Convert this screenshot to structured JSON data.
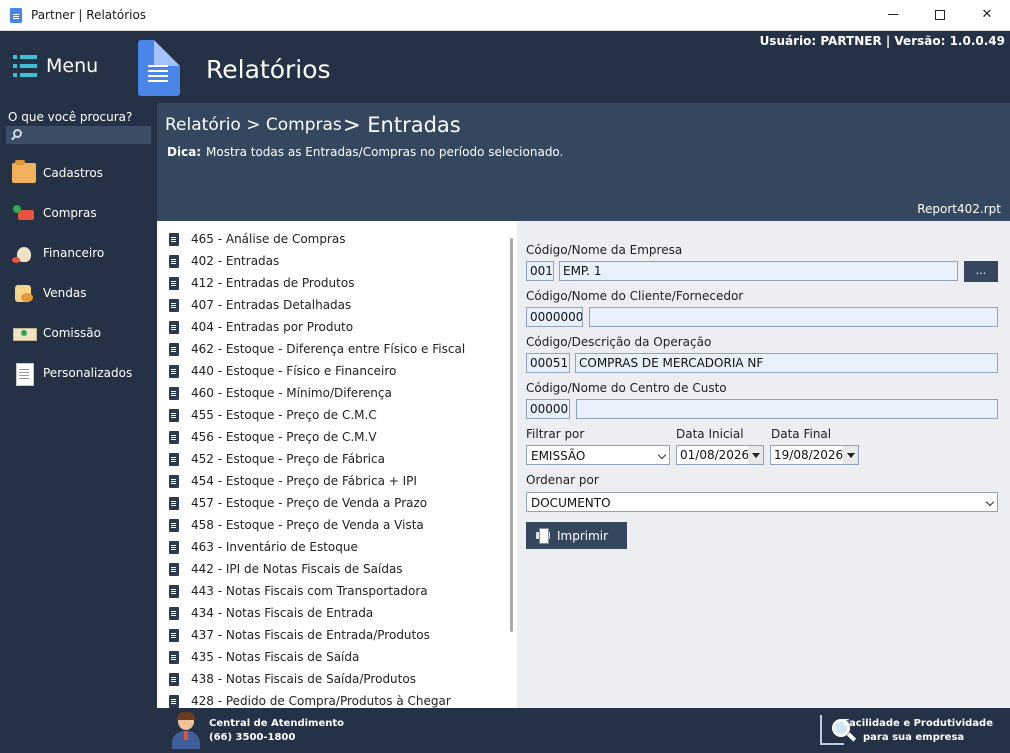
{
  "window": {
    "title": "Partner | Relatórios"
  },
  "header": {
    "menu_label": "Menu",
    "page_title": "Relatórios",
    "user_info": "Usuário: PARTNER | Versão: 1.0.0.49"
  },
  "sidebar": {
    "search_label": "O que você procura?",
    "items": [
      {
        "label": "Cadastros",
        "icon": "folder-icon"
      },
      {
        "label": "Compras",
        "icon": "truck-icon"
      },
      {
        "label": "Financeiro",
        "icon": "money-bag-icon"
      },
      {
        "label": "Vendas",
        "icon": "sales-icon"
      },
      {
        "label": "Comissão",
        "icon": "banknote-icon"
      },
      {
        "label": "Personalizados",
        "icon": "document-icon"
      }
    ]
  },
  "breadcrumb": {
    "path": "Relatório > Compras",
    "current": "> Entradas",
    "tip_label": "Dica:",
    "tip_text": "Mostra todas as Entradas/Compras no período selecionado.",
    "report_file": "Report402.rpt"
  },
  "reports": [
    "465 - Análise de Compras",
    "402 - Entradas",
    "412 - Entradas de Produtos",
    "407 - Entradas Detalhadas",
    "404 - Entradas por Produto",
    "462 - Estoque - Diferença entre Físico e Fiscal",
    "440 - Estoque - Físico e Financeiro",
    "460 - Estoque - Mínimo/Diferença",
    "455 - Estoque - Preço de C.M.C",
    "456 - Estoque - Preço de C.M.V",
    "452 - Estoque - Preço de Fábrica",
    "454 - Estoque - Preço de Fábrica + IPI",
    "457 - Estoque - Preço de Venda a Prazo",
    "458 - Estoque - Preço de Venda a Vista",
    "463 - Inventário de Estoque",
    "442 - IPI de Notas Fiscais de Saídas",
    "443 - Notas Fiscais com Transportadora",
    "434 - Notas Fiscais de Entrada",
    "437 - Notas Fiscais de Entrada/Produtos",
    "435 - Notas Fiscais de Saída",
    "438 - Notas Fiscais de Saída/Produtos",
    "428 - Pedido de Compra/Produtos à Chegar"
  ],
  "form": {
    "empresa_label": "Código/Nome da Empresa",
    "empresa_code": "001",
    "empresa_name": "EMP. 1",
    "lookup_button": "...",
    "cliente_label": "Código/Nome do Cliente/Fornecedor",
    "cliente_code": "0000000",
    "cliente_name": "",
    "operacao_label": "Código/Descrição da Operação",
    "operacao_code": "00051",
    "operacao_desc": "COMPRAS DE MERCADORIA NF",
    "centro_label": "Código/Nome do Centro de Custo",
    "centro_code": "00000",
    "centro_name": "",
    "filtrar_label": "Filtrar por",
    "filtrar_value": "EMISSÃO",
    "data_inicial_label": "Data Inicial",
    "data_inicial": "01/08/2026",
    "data_final_label": "Data Final",
    "data_final": "19/08/2026",
    "ordenar_label": "Ordenar por",
    "ordenar_value": "DOCUMENTO",
    "print_button": "Imprimir"
  },
  "footer": {
    "central_title": "Central de Atendimento",
    "central_phone": "(66) 3500-1800",
    "slogan_line1": "Facilidade e Produtividade",
    "slogan_line2": "para sua empresa"
  }
}
